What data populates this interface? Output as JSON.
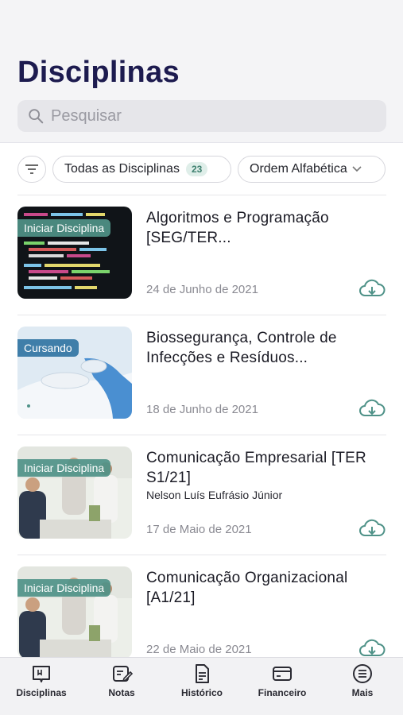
{
  "header": {
    "title": "Disciplinas",
    "search_placeholder": "Pesquisar"
  },
  "filters": {
    "all_label": "Todas as Disciplinas",
    "all_count": "23",
    "order_label": "Ordem Alfabética"
  },
  "courses": [
    {
      "title": "Algoritmos e Programação [SEG/TER...",
      "subtitle": "",
      "date": "24 de Junho de 2021",
      "status": "Iniciar Disciplina",
      "image": "code-screen"
    },
    {
      "title": "Biossegurança, Controle de Infecções e Resíduos...",
      "subtitle": "",
      "date": "18 de Junho de 2021",
      "status": "Cursando",
      "image": "gloved-hands"
    },
    {
      "title": "Comunicação Empresarial [TER S1/21]",
      "subtitle": "Nelson Luís Eufrásio Júnior",
      "date": "17 de Maio de 2021",
      "status": "Iniciar Disciplina",
      "image": "office-meeting"
    },
    {
      "title": "Comunicação Organizacional [A1/21]",
      "subtitle": "",
      "date": "22 de Maio de 2021",
      "status": "Iniciar Disciplina",
      "image": "office-meeting"
    }
  ],
  "nav": {
    "items": [
      {
        "label": "Disciplinas",
        "icon": "book-icon"
      },
      {
        "label": "Notas",
        "icon": "notes-icon"
      },
      {
        "label": "Histórico",
        "icon": "document-icon"
      },
      {
        "label": "Financeiro",
        "icon": "card-icon"
      },
      {
        "label": "Mais",
        "icon": "menu-icon"
      }
    ]
  },
  "colors": {
    "title": "#1d1b4f",
    "accent_teal": "#4f9288",
    "status_blue": "#3f7ea9"
  }
}
